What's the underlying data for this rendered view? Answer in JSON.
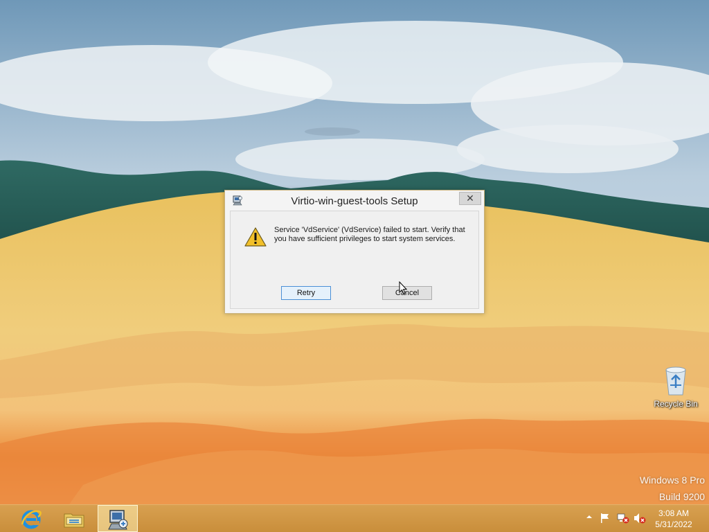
{
  "desktop": {
    "icons": [
      {
        "label": "Recycle Bin",
        "icon": "recycle-bin-icon"
      }
    ],
    "watermark": {
      "os": "Windows 8 Pro",
      "build": "Build 9200"
    }
  },
  "dialog": {
    "title": "Virtio-win-guest-tools Setup",
    "close_glyph": "✕",
    "message": "Service 'VdService' (VdService) failed to start.  Verify that you have sufficient privileges to start system services.",
    "buttons": {
      "retry": "Retry",
      "cancel": "Cancel"
    },
    "icon": "warning-icon"
  },
  "taskbar": {
    "pinned": [
      {
        "name": "Internet Explorer",
        "icon": "internet-explorer-icon"
      },
      {
        "name": "File Explorer",
        "icon": "file-explorer-icon"
      },
      {
        "name": "Virtio-win-guest-tools Setup",
        "icon": "setup-installer-icon",
        "active": true
      }
    ],
    "tray": {
      "icons": [
        "show-hidden-icons-icon",
        "action-center-flag-icon",
        "network-disconnected-icon",
        "volume-muted-icon"
      ]
    },
    "clock": {
      "time": "3:08 AM",
      "date": "5/31/2022"
    }
  },
  "colors": {
    "taskbar": "#c98e3b",
    "dialog_background": "#f0f0f0",
    "default_button_border": "#4a8fd6"
  }
}
